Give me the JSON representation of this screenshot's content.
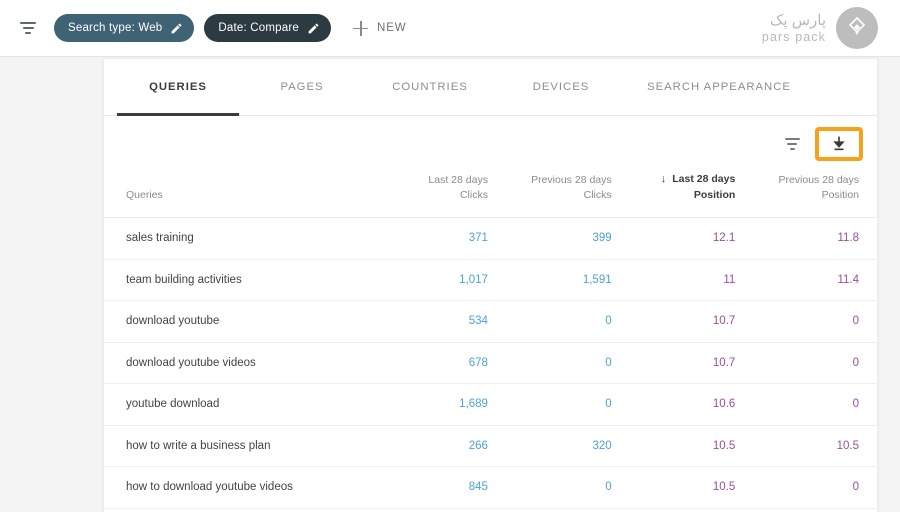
{
  "toolbar": {
    "filter_icon": "filter-icon",
    "chips": [
      {
        "label": "Search type: Web",
        "edit_icon": "pencil-icon",
        "color": "#3f6274"
      },
      {
        "label": "Date: Compare",
        "edit_icon": "pencil-icon",
        "color": "#2c3a42"
      }
    ],
    "new_button": {
      "label": "NEW",
      "icon": "plus-icon"
    },
    "brand": {
      "persian": "پارس پک",
      "latin": "pars pack",
      "mark_icon": "diamond-logo-icon"
    }
  },
  "card": {
    "tabs": [
      {
        "label": "QUERIES",
        "active": true
      },
      {
        "label": "PAGES",
        "active": false
      },
      {
        "label": "COUNTRIES",
        "active": false
      },
      {
        "label": "DEVICES",
        "active": false
      },
      {
        "label": "SEARCH APPEARANCE",
        "active": false
      }
    ],
    "actions": {
      "filter_icon": "filter-icon",
      "download_icon": "download-icon",
      "download_highlight_color": "#f5a21e"
    },
    "table": {
      "headers": [
        {
          "line1": "",
          "line2": "Queries",
          "sorted": false
        },
        {
          "line1": "Last 28 days",
          "line2": "Clicks",
          "sorted": false
        },
        {
          "line1": "Previous 28 days",
          "line2": "Clicks",
          "sorted": false
        },
        {
          "line1": "Last 28 days",
          "line2": "Position",
          "sorted": true,
          "sort_arrow": "↓"
        },
        {
          "line1": "Previous 28 days",
          "line2": "Position",
          "sorted": false
        }
      ],
      "rows": [
        {
          "query": "sales training",
          "clicks_last": "371",
          "clicks_prev": "399",
          "pos_last": "12.1",
          "pos_prev": "11.8"
        },
        {
          "query": "team building activities",
          "clicks_last": "1,017",
          "clicks_prev": "1,591",
          "pos_last": "11",
          "pos_prev": "11.4"
        },
        {
          "query": "download youtube",
          "clicks_last": "534",
          "clicks_prev": "0",
          "pos_last": "10.7",
          "pos_prev": "0"
        },
        {
          "query": "download youtube videos",
          "clicks_last": "678",
          "clicks_prev": "0",
          "pos_last": "10.7",
          "pos_prev": "0"
        },
        {
          "query": "youtube download",
          "clicks_last": "1,689",
          "clicks_prev": "0",
          "pos_last": "10.6",
          "pos_prev": "0"
        },
        {
          "query": "how to write a business plan",
          "clicks_last": "266",
          "clicks_prev": "320",
          "pos_last": "10.5",
          "pos_prev": "10.5"
        },
        {
          "query": "how to download youtube videos",
          "clicks_last": "845",
          "clicks_prev": "0",
          "pos_last": "10.5",
          "pos_prev": "0"
        }
      ],
      "colors": {
        "clicks": "#4ba3d3",
        "position": "#9c4d9c"
      }
    }
  }
}
